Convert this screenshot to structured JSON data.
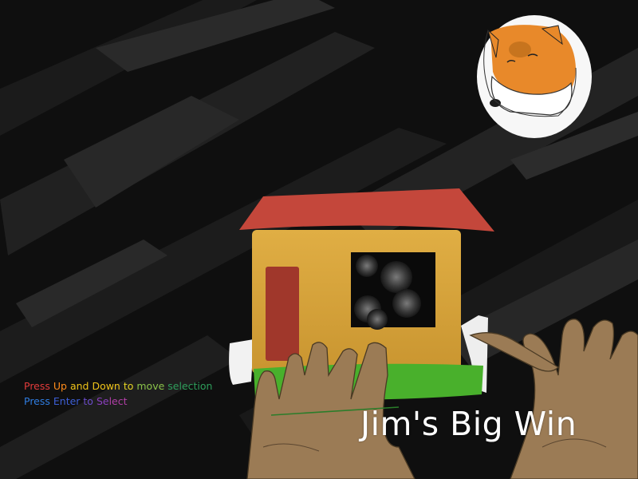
{
  "game": {
    "title": "Jim's Big Win"
  },
  "instructions": {
    "line1": [
      {
        "text": "Press ",
        "color": "#e23b3b"
      },
      {
        "text": "Up ",
        "color": "#ff8c1a"
      },
      {
        "text": "and ",
        "color": "#f0c419"
      },
      {
        "text": "Down ",
        "color": "#f0c419"
      },
      {
        "text": "to ",
        "color": "#e6d422"
      },
      {
        "text": "move ",
        "color": "#8bc34a"
      },
      {
        "text": "selection",
        "color": "#2e9e5b"
      }
    ],
    "line2": [
      {
        "text": "Press ",
        "color": "#2f7de1"
      },
      {
        "text": "Enter ",
        "color": "#3d5fd6"
      },
      {
        "text": "to ",
        "color": "#6a4bc9"
      },
      {
        "text": "Se",
        "color": "#8b3fbf"
      },
      {
        "text": "lect",
        "color": "#b23fa8"
      }
    ]
  },
  "colors": {
    "background": "#0e0e0e",
    "roof": "#c4473b",
    "house_wall": "#d9a63a",
    "door": "#a0372b",
    "grass": "#49b02c",
    "fur": "#e8892a",
    "hands": "#9b7b55"
  },
  "icons": {
    "dog_portrait": "dog-face-icon",
    "house": "house-illustration",
    "hands": "hands-illustration"
  }
}
